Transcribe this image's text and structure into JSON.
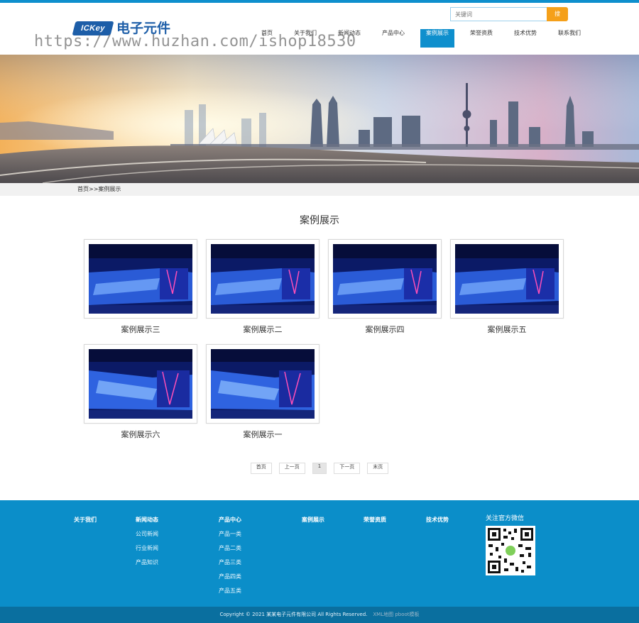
{
  "header": {
    "logo_badge": "ICKey",
    "logo_text": "电子元件",
    "search_placeholder": "关键词",
    "search_button": "搜",
    "nav": [
      {
        "label": "首页",
        "active": false
      },
      {
        "label": "关于我们",
        "active": false
      },
      {
        "label": "新闻动态",
        "active": false
      },
      {
        "label": "产品中心",
        "active": false
      },
      {
        "label": "案例展示",
        "active": true
      },
      {
        "label": "荣誉资质",
        "active": false
      },
      {
        "label": "技术优势",
        "active": false
      },
      {
        "label": "联系我们",
        "active": false
      }
    ],
    "watermark": "https://www.huzhan.com/ishop18530"
  },
  "breadcrumb": "首页>>案例展示",
  "section_title": "案例展示",
  "cases": [
    {
      "title": "案例展示三"
    },
    {
      "title": "案例展示二"
    },
    {
      "title": "案例展示四"
    },
    {
      "title": "案例展示五"
    },
    {
      "title": "案例展示六"
    },
    {
      "title": "案例展示一"
    }
  ],
  "pagination": {
    "first": "首页",
    "prev": "上一页",
    "current": "1",
    "next": "下一页",
    "last": "末页"
  },
  "footer": {
    "columns": [
      {
        "title": "关于我们",
        "links": []
      },
      {
        "title": "新闻动态",
        "links": [
          "公司新闻",
          "行业新闻",
          "产品知识"
        ]
      },
      {
        "title": "产品中心",
        "links": [
          "产品一类",
          "产品二类",
          "产品三类",
          "产品四类",
          "产品五类"
        ]
      },
      {
        "title": "案例展示",
        "links": []
      },
      {
        "title": "荣誉资质",
        "links": []
      },
      {
        "title": "技术优势",
        "links": []
      }
    ],
    "wechat_title": "关注官方微信",
    "copyright": "Copyright © 2021 某某电子元件有限公司 All Rights Reserved.",
    "icp": "XML地图 pboot模板"
  },
  "colors": {
    "accent": "#0e8fcd",
    "search_button": "#f5a01a",
    "footer_bg": "#0b8ec9",
    "footer_bottom": "#0a6f9f"
  }
}
